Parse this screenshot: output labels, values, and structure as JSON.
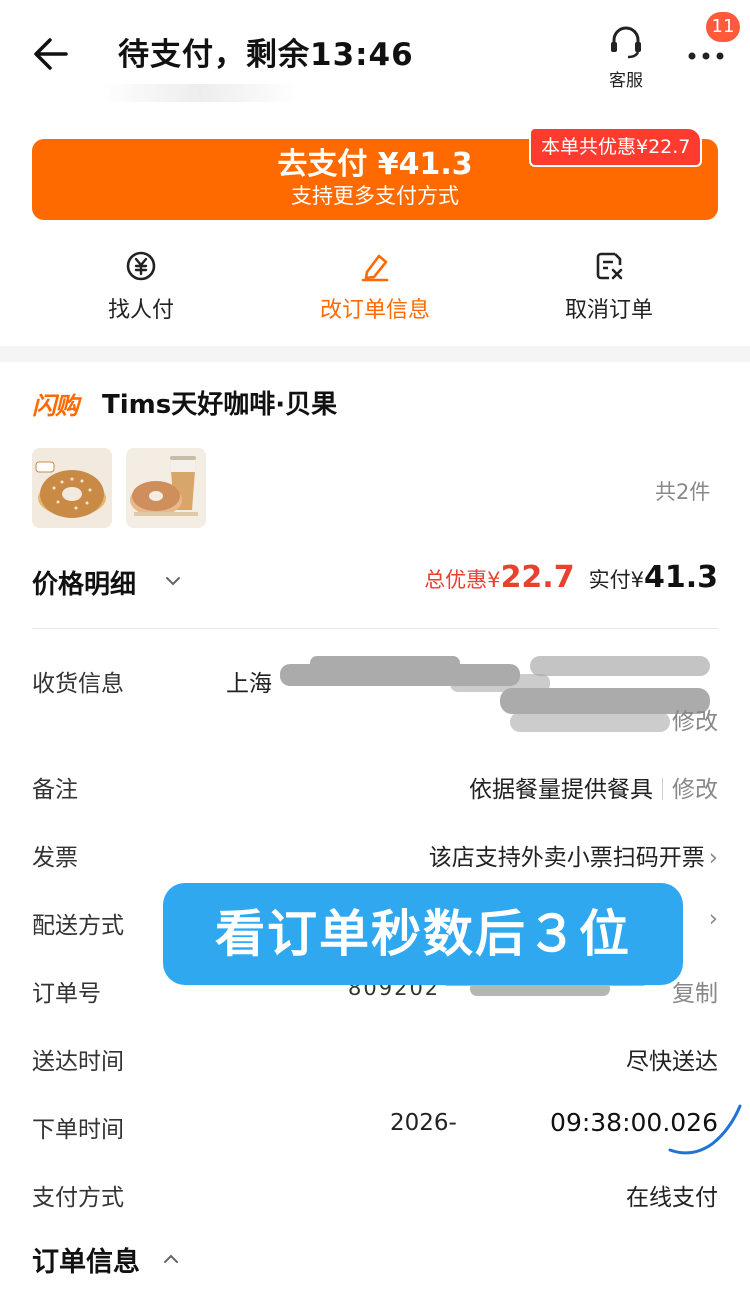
{
  "header": {
    "title": "待支付，剩余13:46",
    "service_label": "客服",
    "badge_count": "11"
  },
  "pay": {
    "main_label": "去支付 ¥41.3",
    "sub_label": "支持更多支付方式",
    "discount_tag": "本单共优惠¥22.7"
  },
  "actions": [
    {
      "label": "找人付",
      "icon": "yuan-share-icon"
    },
    {
      "label": "改订单信息",
      "icon": "edit-icon"
    },
    {
      "label": "取消订单",
      "icon": "cancel-order-icon"
    }
  ],
  "store": {
    "flash_tag": "闪购",
    "name": "Tims天好咖啡·贝果",
    "item_count": "共2件"
  },
  "price": {
    "title": "价格明细",
    "discount_label": "总优惠¥",
    "discount_amount": "22.7",
    "paid_label": "实付¥",
    "paid_amount": "41.3"
  },
  "details": {
    "address": {
      "label": "收货信息",
      "value": "上海",
      "action": "修改"
    },
    "remark": {
      "label": "备注",
      "value": "依据餐量提供餐具",
      "action": "修改"
    },
    "invoice": {
      "label": "发票",
      "value": "该店支持外卖小票扫码开票"
    },
    "delivery_method": {
      "label": "配送方式"
    },
    "order_no": {
      "label": "订单号",
      "value": "809202",
      "action": "复制"
    },
    "delivery_time": {
      "label": "送达时间",
      "value": "尽快送达"
    },
    "order_time": {
      "label": "下单时间",
      "value_date": "2026-",
      "value_time": "09:38:00.026"
    },
    "payment": {
      "label": "支付方式",
      "value": "在线支付"
    }
  },
  "overlay_text": "看订单秒数后３位",
  "order_info_title": "订单信息",
  "colors": {
    "accent": "#ff6a00",
    "discount_red": "#e8412f",
    "overlay_blue": "#2fa8f0"
  }
}
